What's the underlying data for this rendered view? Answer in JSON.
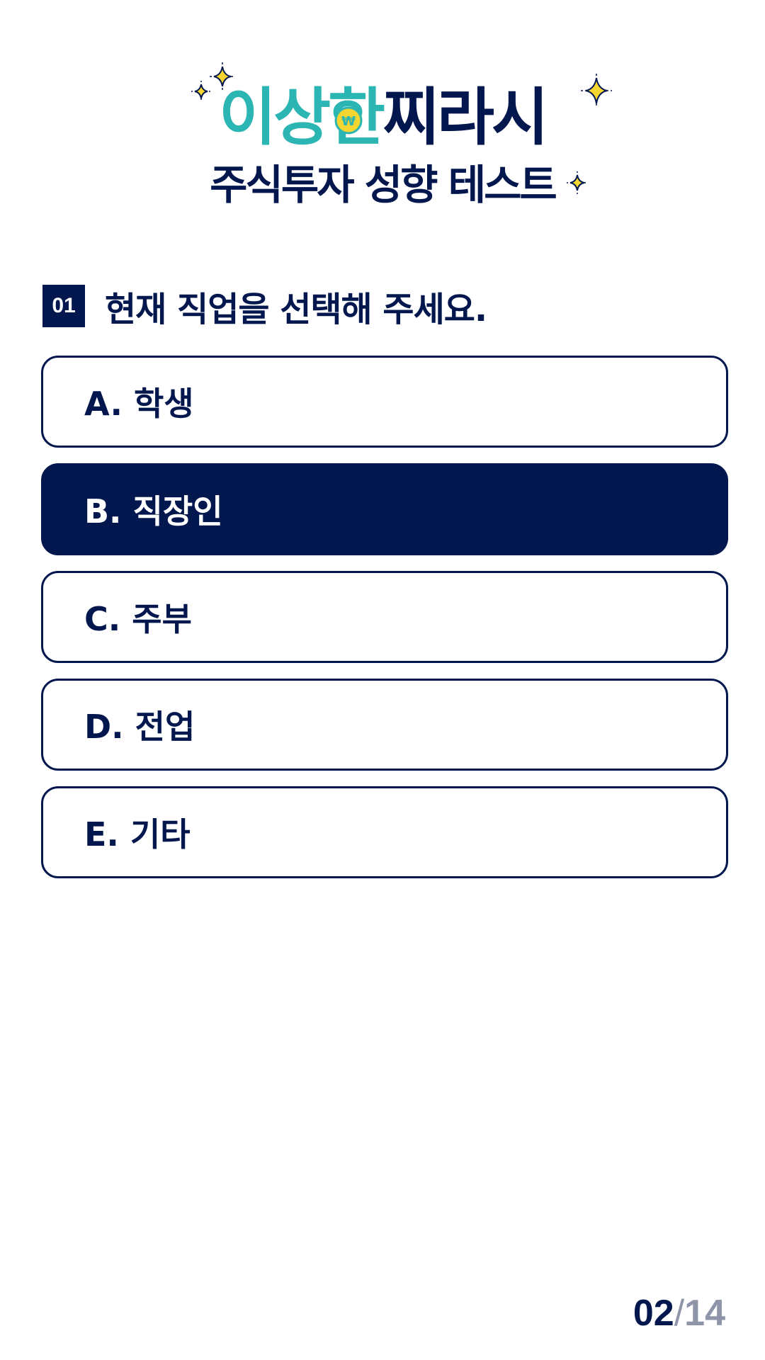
{
  "logo": {
    "line1_part1": "이상",
    "line1_coin_char": "한",
    "line1_part2": "찌라시",
    "line2": "주식투자 성향 테스트",
    "coin_symbol": "₩"
  },
  "question": {
    "number": "01",
    "text": "현재 직업을 선택해 주세요."
  },
  "options": [
    {
      "label": "A. 학생",
      "selected": false
    },
    {
      "label": "B. 직장인",
      "selected": true
    },
    {
      "label": "C. 주부",
      "selected": false
    },
    {
      "label": "D. 전업",
      "selected": false
    },
    {
      "label": "E. 기타",
      "selected": false
    }
  ],
  "progress": {
    "current": "02",
    "separator": "/",
    "total": "14"
  },
  "colors": {
    "navy": "#03174f",
    "teal": "#2bb5b3",
    "sparkle": "#f5d532",
    "muted": "#8e95a8"
  },
  "icons": [
    "sparkle-icon",
    "won-coin-icon"
  ]
}
